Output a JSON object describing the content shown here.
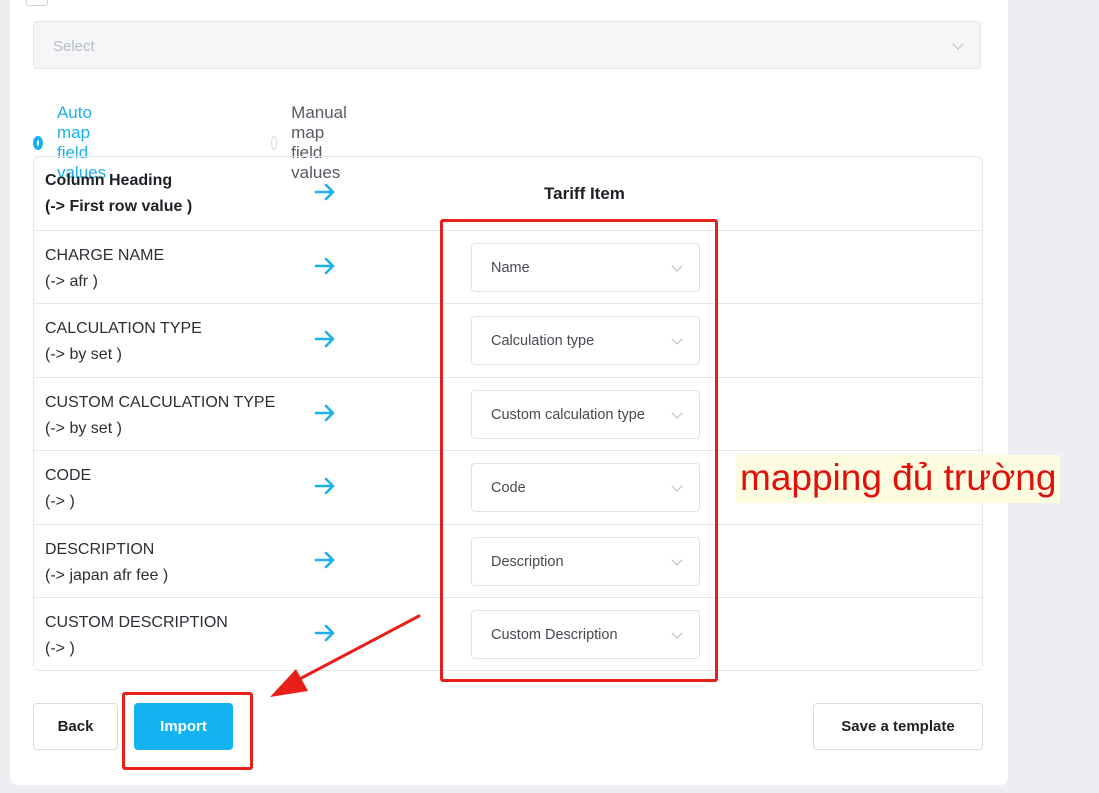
{
  "select": {
    "placeholder": "Select"
  },
  "mapping_mode": {
    "auto_label": "Auto map field values",
    "manual_label": "Manual map field values",
    "selected": "auto"
  },
  "table": {
    "header": {
      "col_heading": "Column Heading",
      "col_sub": "(-> First row value )",
      "tariff_heading": "Tariff Item"
    },
    "rows": [
      {
        "name": "CHARGE NAME",
        "value": "(-> afr )",
        "mapping": "Name"
      },
      {
        "name": "CALCULATION TYPE",
        "value": "(-> by set )",
        "mapping": "Calculation type"
      },
      {
        "name": "CUSTOM CALCULATION TYPE",
        "value": "(-> by set )",
        "mapping": "Custom calculation type"
      },
      {
        "name": "CODE",
        "value": "(-> )",
        "mapping": "Code"
      },
      {
        "name": "DESCRIPTION",
        "value": "(-> japan afr fee )",
        "mapping": "Description"
      },
      {
        "name": "CUSTOM DESCRIPTION",
        "value": "(-> )",
        "mapping": "Custom Description"
      }
    ]
  },
  "annotation": {
    "text": "mapping đủ trường",
    "color": "#e0100a"
  },
  "buttons": {
    "back": "Back",
    "import": "Import",
    "save_template": "Save a template"
  },
  "colors": {
    "accent": "#12b3ee",
    "annotation_red": "#e8201a"
  }
}
